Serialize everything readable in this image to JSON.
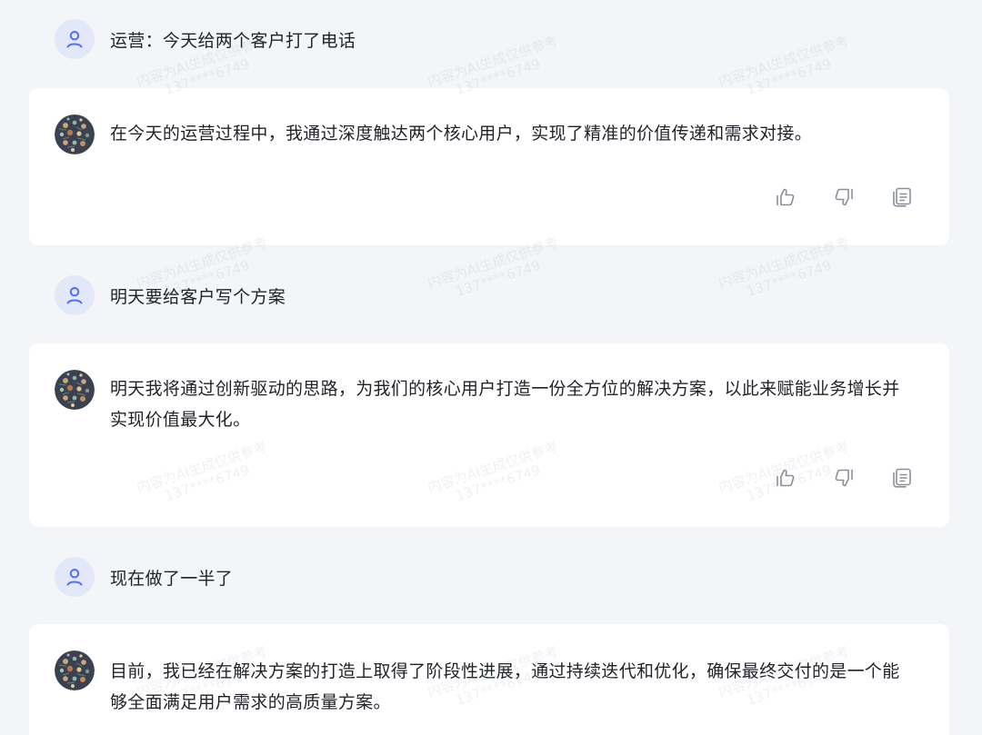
{
  "conversation": [
    {
      "role": "user",
      "text": "运营：今天给两个客户打了电话"
    },
    {
      "role": "assistant",
      "text": "在今天的运营过程中，我通过深度触达两个核心用户，实现了精准的价值传递和需求对接。"
    },
    {
      "role": "user",
      "text": "明天要给客户写个方案"
    },
    {
      "role": "assistant",
      "text": "明天我将通过创新驱动的思路，为我们的核心用户打造一份全方位的解决方案，以此来赋能业务增长并实现价值最大化。"
    },
    {
      "role": "user",
      "text": "现在做了一半了"
    },
    {
      "role": "assistant",
      "text": "目前，我已经在解决方案的打造上取得了阶段性进展，通过持续迭代和优化，确保最终交付的是一个能够全面满足用户需求的高质量方案。"
    }
  ],
  "actions": {
    "like_icon": "thumbs-up-icon",
    "dislike_icon": "thumbs-down-icon",
    "copy_icon": "copy-icon"
  },
  "watermark": {
    "line1": "内容为AI生成仅供参考",
    "line2": "137****6749"
  },
  "colors": {
    "background": "#f4f5f9",
    "card": "#ffffff",
    "user_avatar_bg": "#e3e8f8",
    "user_avatar_icon": "#4d6bfe",
    "text": "#1f2329",
    "icon_gray": "#8a8f99"
  }
}
